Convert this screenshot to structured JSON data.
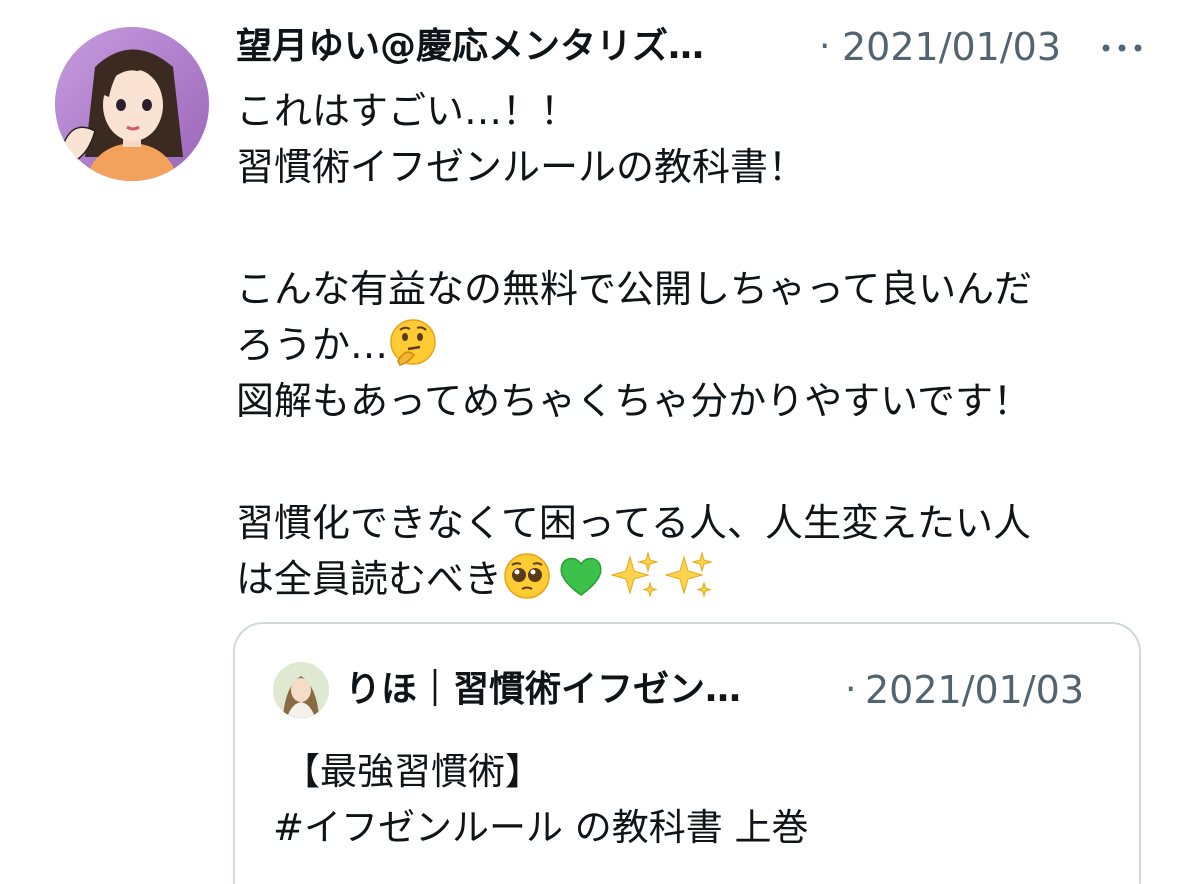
{
  "tweet": {
    "author_name": "望月ゆい@慶応メンタリズ…",
    "separator": "·",
    "date": "2021/01/03",
    "more_icon": "ellipsis-icon",
    "lines": [
      "これはすごい…！！",
      "習慣術イフゼンルールの教科書！",
      "こんな有益なの無料で公開しちゃって良いんだ",
      "ろうか…",
      "図解もあってめちゃくちゃ分かりやすいです！",
      "習慣化できなくて困ってる人、人生変えたい人",
      "は全員読むべき"
    ],
    "emojis": [
      "thinking-face-emoji",
      "pleading-face-emoji",
      "green-heart-emoji",
      "sparkles-emoji",
      "sparkles-emoji"
    ]
  },
  "quoted_tweet": {
    "author_name": "りほ｜習慣術イフゼン…",
    "separator": "·",
    "date": "2021/01/03",
    "lines": [
      "【最強習慣術】",
      "#イフゼンルール の教科書 上巻"
    ]
  },
  "colors": {
    "text": "#0f1419",
    "secondary": "#536471",
    "border": "#cfd9de",
    "avatar_bg": "#b98ad0"
  }
}
